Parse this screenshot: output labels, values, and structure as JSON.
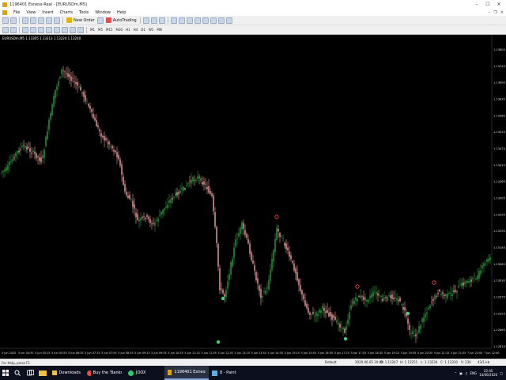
{
  "window": {
    "title": "1196401 Exness-Real - [EURUSDm,M5]"
  },
  "menu": [
    "File",
    "View",
    "Insert",
    "Charts",
    "Tools",
    "Window",
    "Help"
  ],
  "toolbar": {
    "new_order": "New Order",
    "auto_trading": "AutoTrading"
  },
  "timeframes": [
    "M1",
    "M5",
    "M15",
    "M30",
    "H1",
    "H4",
    "D1",
    "W1",
    "MN"
  ],
  "chart": {
    "header": "EURUSDm,M5 1.13305 1.13313 1.13224 1.13240",
    "price_labels": [
      "1.13805",
      "1.13745",
      "1.13690",
      "1.13635",
      "1.13580",
      "1.13525",
      "1.13470",
      "1.13415",
      "1.13360",
      "1.13305",
      "1.13250",
      "1.13195",
      "1.13140",
      "1.13085",
      "1.13030",
      "1.12975",
      "1.12920",
      "1.12865",
      "1.12810"
    ],
    "time_labels": [
      "5 Jun 2020",
      "5 Jun 04:35",
      "5 Jun 05:15",
      "5 Jun 05:55",
      "5 Jun 06:35",
      "5 Jun 07:15",
      "5 Jun 07:55",
      "5 Jun 08:35",
      "5 Jun 09:15",
      "5 Jun 09:55",
      "5 Jun 10:35",
      "5 Jun 11:15",
      "5 Jun 11:55",
      "5 Jun 12:35",
      "5 Jun 13:15",
      "5 Jun 13:55",
      "5 Jun 14:35",
      "5 Jun 15:15",
      "5 Jun 15:55",
      "5 Jun 16:35",
      "5 Jun 17:15",
      "5 Jun 17:55",
      "5 Jun 18:35",
      "5 Jun 19:15",
      "5 Jun 19:55",
      "5 Jun 20:35",
      "5 Jun 21:15",
      "5 Jun 21:55",
      "7 Jun 22:00",
      "7 Jun 22:40"
    ],
    "colors": {
      "up": "#2f9e3f",
      "down": "#f4a0a0",
      "marker_up": "#3fd17a",
      "marker_down": "#ff4d4d"
    }
  },
  "status": {
    "help": "For Help, press F1",
    "profile": "Default",
    "datetime": "2020.06.05 10:00",
    "open": "O: 1.13247",
    "high": "H: 1.13251",
    "low": "L: 1.13234",
    "close": "C: 1.13310",
    "volume": "V: 236",
    "traffic": "43/1 kb"
  },
  "taskbar": {
    "items": [
      {
        "label": "Downloads"
      },
      {
        "label": "Buy the 'Banks Bina..."
      },
      {
        "label": "JOOX"
      },
      {
        "label": "1196401 Exness-R..."
      },
      {
        "label": "8 - Paint"
      }
    ],
    "language": "ENG",
    "time": "22:45",
    "date": "14/06/2020"
  }
}
